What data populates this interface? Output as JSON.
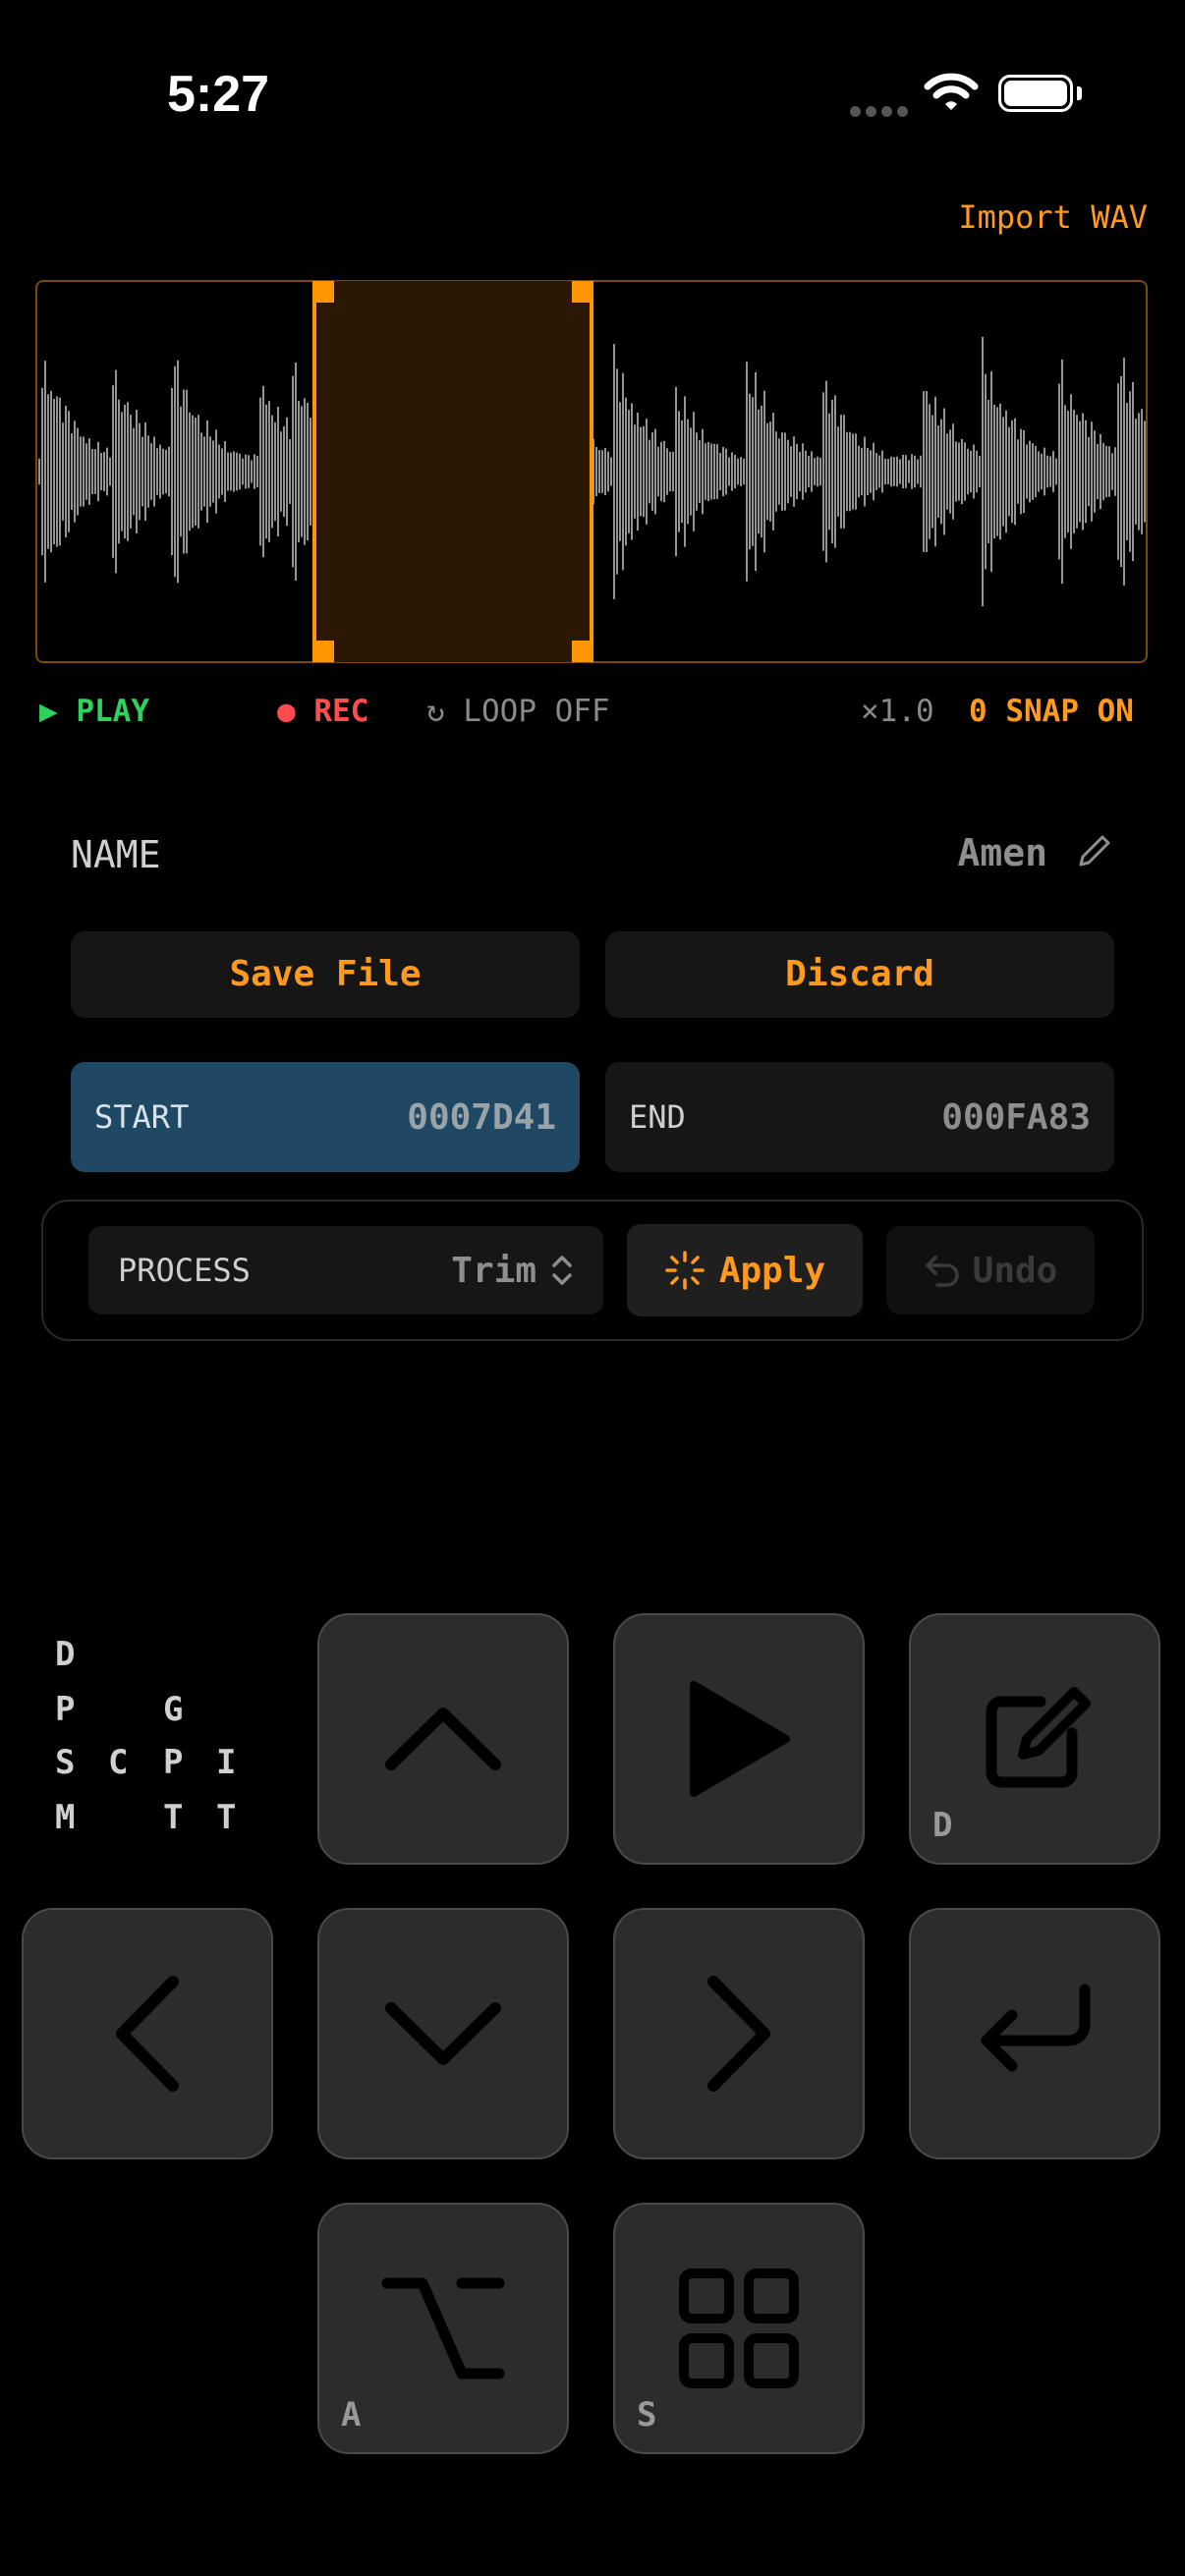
{
  "status_bar": {
    "time": "5:27"
  },
  "header": {
    "import_label": "Import WAV"
  },
  "transport": {
    "play_label": "▶ PLAY",
    "rec_label": "● REC",
    "loop_label": "↻ LOOP OFF",
    "speed_label": "×1.0",
    "snap_label": "0 SNAP ON"
  },
  "sample": {
    "name_label": "NAME",
    "name_value": "Amen"
  },
  "actions": {
    "save_label": "Save File",
    "discard_label": "Discard"
  },
  "range": {
    "start_label": "START",
    "start_value": "0007D41",
    "end_label": "END",
    "end_value": "000FA83"
  },
  "process": {
    "label": "PROCESS",
    "value": "Trim",
    "apply_label": "Apply",
    "undo_label": "Undo"
  },
  "grid_letters": {
    "row1": [
      "D",
      "",
      ""
    ],
    "row2": [
      "P",
      "",
      "G"
    ],
    "row3": [
      "S",
      "C",
      "P",
      "I"
    ],
    "row4": [
      "M",
      "",
      "T",
      "T"
    ]
  },
  "keys": {
    "edit_letter": "D",
    "alt_letter": "A",
    "grid_letter": "S"
  },
  "colors": {
    "accent": "#ff9a1f",
    "play": "#2ed35d",
    "rec": "#ff4d4d",
    "start_bg": "#1e4863"
  },
  "icons": [
    "wifi-icon",
    "battery-icon",
    "pencil-icon",
    "chevron-updown-icon",
    "sparkle-icon",
    "undo-icon",
    "up-arrow-icon",
    "play-icon",
    "edit-icon",
    "left-arrow-icon",
    "down-arrow-icon",
    "right-arrow-icon",
    "return-icon",
    "option-icon",
    "grid-icon"
  ]
}
